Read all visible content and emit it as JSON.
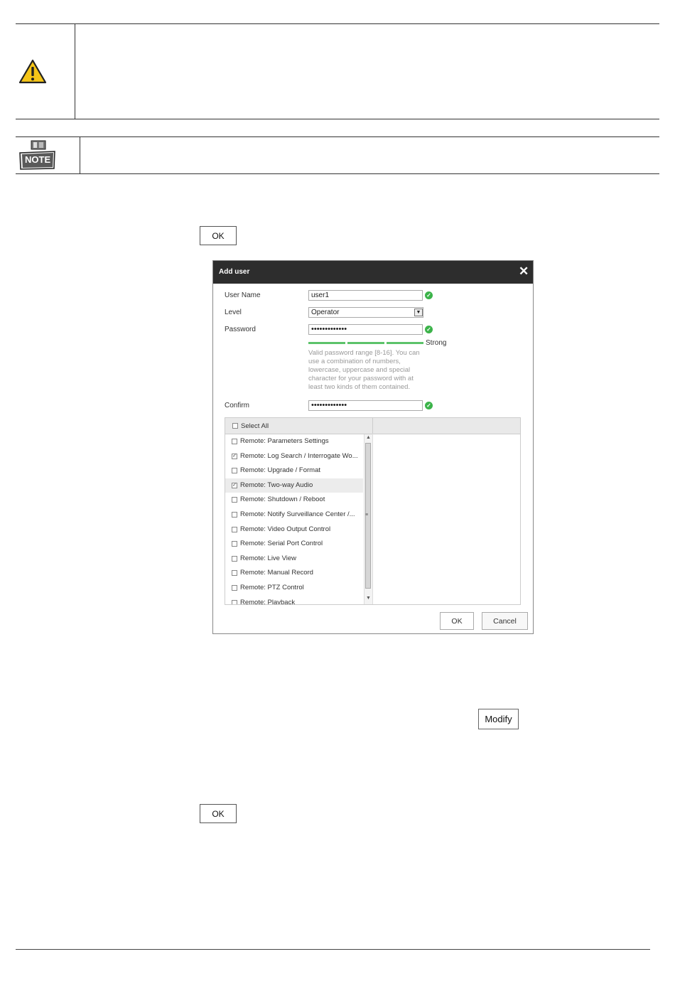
{
  "caution": {
    "icon": "warning-triangle-icon"
  },
  "note": {
    "icon": "note-icon",
    "badge_text": "NOTE"
  },
  "buttons": {
    "ok_top": "OK",
    "modify": "Modify",
    "ok_bottom": "OK"
  },
  "dialog": {
    "title": "Add user",
    "close_icon": "✕",
    "fields": {
      "user_name_label": "User Name",
      "user_name_value": "user1",
      "level_label": "Level",
      "level_value": "Operator",
      "password_label": "Password",
      "password_value": "•••••••••••••",
      "strength_label": "Strong",
      "password_hint": "Valid password range [8-16]. You can use a combination of numbers, lowercase, uppercase and special character for your password with at least two kinds of them contained.",
      "confirm_label": "Confirm",
      "confirm_value": "•••••••••••••"
    },
    "permissions": {
      "select_all": "Select All",
      "items": [
        {
          "label": "Remote: Parameters Settings",
          "checked": false,
          "highlighted": false
        },
        {
          "label": "Remote: Log Search / Interrogate Wo...",
          "checked": true,
          "highlighted": false
        },
        {
          "label": "Remote: Upgrade / Format",
          "checked": false,
          "highlighted": false
        },
        {
          "label": "Remote: Two-way Audio",
          "checked": true,
          "highlighted": true
        },
        {
          "label": "Remote: Shutdown / Reboot",
          "checked": false,
          "highlighted": false
        },
        {
          "label": "Remote: Notify Surveillance Center /...",
          "checked": false,
          "highlighted": false
        },
        {
          "label": "Remote: Video Output Control",
          "checked": false,
          "highlighted": false
        },
        {
          "label": "Remote: Serial Port Control",
          "checked": false,
          "highlighted": false
        },
        {
          "label": "Remote: Live View",
          "checked": false,
          "highlighted": false
        },
        {
          "label": "Remote: Manual Record",
          "checked": false,
          "highlighted": false
        },
        {
          "label": "Remote: PTZ Control",
          "checked": false,
          "highlighted": false
        },
        {
          "label": "Remote: Playback",
          "checked": false,
          "highlighted": false
        }
      ]
    },
    "ok_label": "OK",
    "cancel_label": "Cancel"
  },
  "colors": {
    "dialog_header": "#2d2d2d",
    "valid_check": "#3cb34a",
    "strength_bar": "#5cc36a",
    "warning_yellow": "#f5c518"
  }
}
